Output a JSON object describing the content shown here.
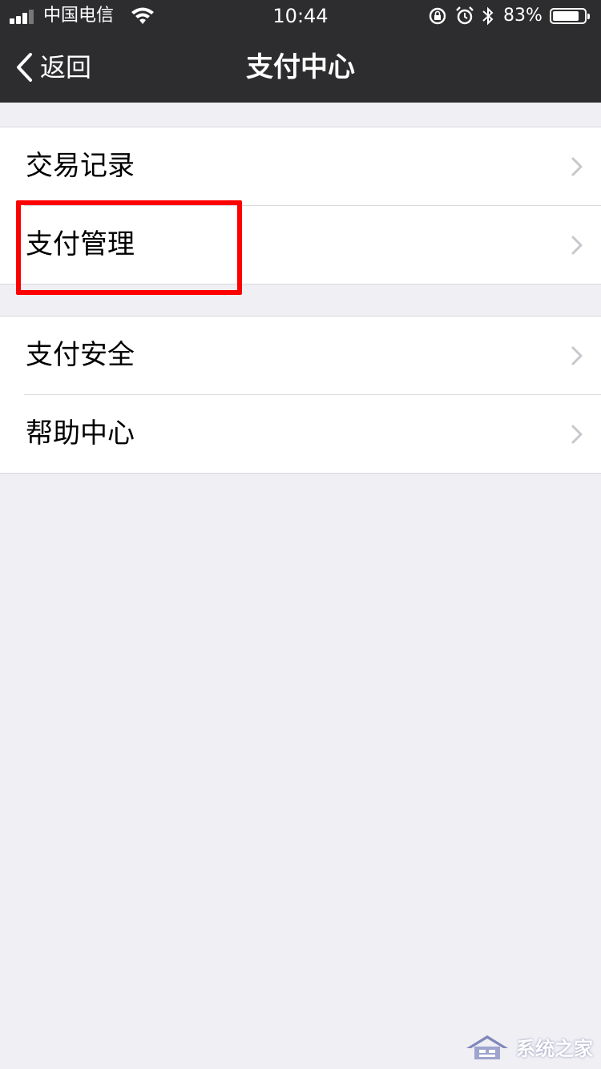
{
  "status_bar": {
    "carrier": "中国电信",
    "time": "10:44",
    "battery_percent": "83%",
    "battery_level": 0.83,
    "icons": [
      "signal-icon",
      "wifi-icon",
      "orientation-lock-icon",
      "alarm-icon",
      "bluetooth-icon",
      "battery-icon"
    ]
  },
  "nav": {
    "back_label": "返回",
    "title": "支付中心"
  },
  "groups": [
    {
      "items": [
        {
          "label": "交易记录"
        },
        {
          "label": "支付管理",
          "highlighted": true
        }
      ]
    },
    {
      "items": [
        {
          "label": "支付安全"
        },
        {
          "label": "帮助中心"
        }
      ]
    }
  ],
  "annotation_color": "#ff0000",
  "watermark": {
    "text": "系统之家"
  }
}
